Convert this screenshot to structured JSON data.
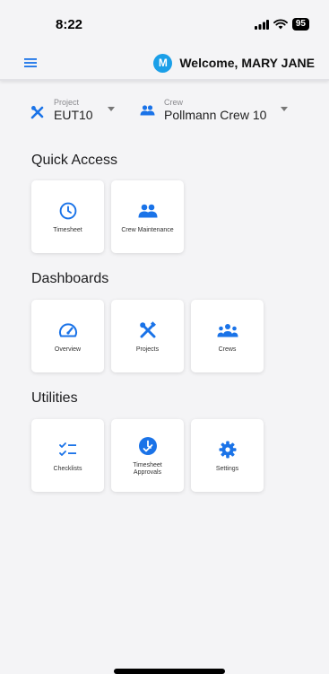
{
  "status_bar": {
    "time": "8:22",
    "battery": "95"
  },
  "header": {
    "welcome": "Welcome, MARY JANE",
    "avatar_letter": "M"
  },
  "filters": {
    "project": {
      "label": "Project",
      "value": "EUT10"
    },
    "crew": {
      "label": "Crew",
      "value": "Pollmann Crew 10"
    }
  },
  "quick_access": {
    "title": "Quick Access",
    "items": [
      {
        "label": "Timesheet",
        "icon": "clock-icon"
      },
      {
        "label": "Crew Maintenance",
        "icon": "group-icon"
      }
    ]
  },
  "dashboards": {
    "title": "Dashboards",
    "items": [
      {
        "label": "Overview",
        "icon": "speedometer-icon"
      },
      {
        "label": "Projects",
        "icon": "tools-icon"
      },
      {
        "label": "Crews",
        "icon": "groups-icon"
      }
    ]
  },
  "utilities": {
    "title": "Utilities",
    "items": [
      {
        "label": "Checklists",
        "icon": "checklist-icon"
      },
      {
        "label": "Timesheet Approvals",
        "icon": "approval-icon"
      },
      {
        "label": "Settings",
        "icon": "gear-icon"
      }
    ]
  },
  "colors": {
    "accent": "#1a73e8",
    "avatar": "#1a9fe8"
  }
}
